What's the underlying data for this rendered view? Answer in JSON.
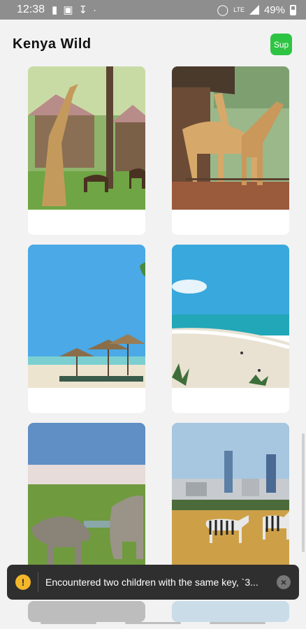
{
  "status_bar": {
    "time": "12:38",
    "battery": "49%",
    "network": "LTE"
  },
  "header": {
    "title": "Kenya Wild",
    "sup_label": "Sup"
  },
  "colors": {
    "accent": "#2ec443",
    "toast_bg": "#2f2f2f",
    "warning": "#f5b72a"
  },
  "cards": [
    {
      "scene": "giraffes-at-lodge"
    },
    {
      "scene": "giraffe-manor"
    },
    {
      "scene": "beach-umbrellas"
    },
    {
      "scene": "beach-shoreline"
    },
    {
      "scene": "rhinos-and-flamingos"
    },
    {
      "scene": "zebras-city-skyline"
    }
  ],
  "toast": {
    "message": "Encountered two children with the same key, `3..."
  }
}
